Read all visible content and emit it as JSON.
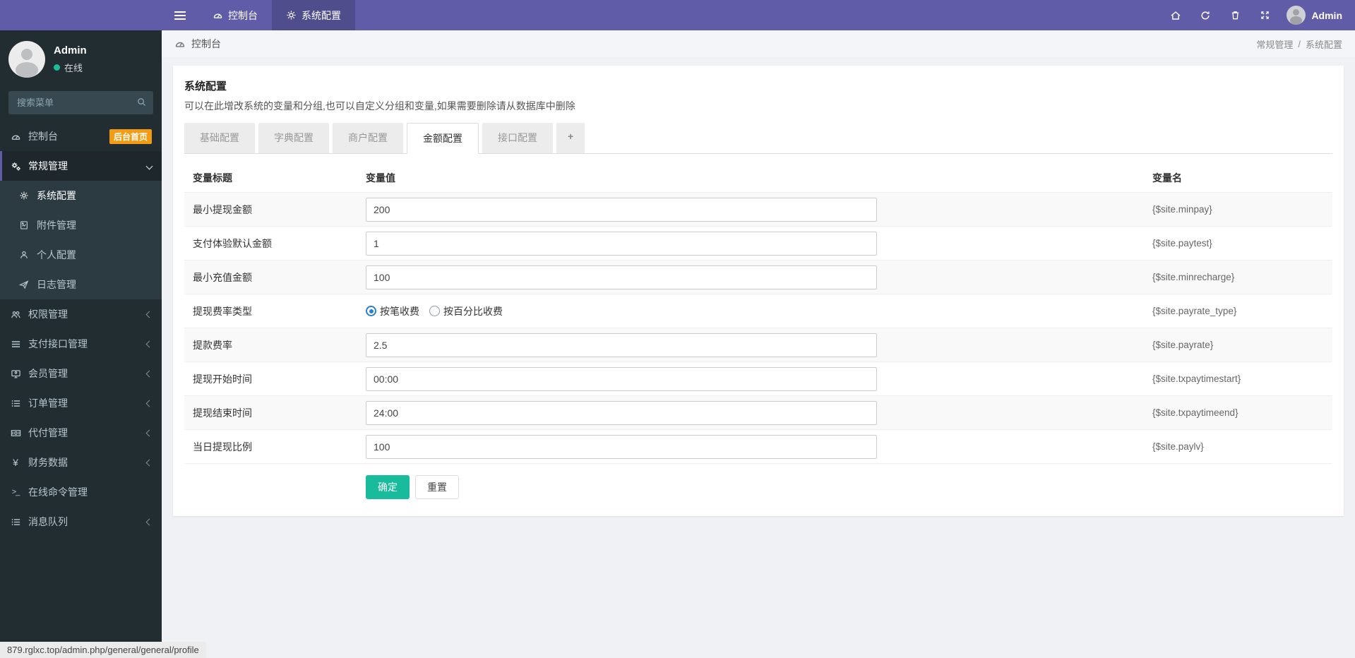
{
  "colors": {
    "navbar_purple": "#605ca8",
    "sidebar_dark": "#222d32",
    "submenu_dark": "#2c3b41",
    "badge_orange": "#f39c12",
    "success_green": "#18bc9c",
    "radio_blue": "#2a7fd1"
  },
  "navbar": {
    "tabs": [
      "控制台",
      "系统配置"
    ],
    "user": "Admin",
    "icons": [
      "home-icon",
      "refresh-icon",
      "trash-icon",
      "expand-icon"
    ]
  },
  "sidebar": {
    "profile": {
      "name": "Admin",
      "status": "在线"
    },
    "search_placeholder": "搜索菜单",
    "menu": [
      {
        "label": "控制台",
        "badge": "后台首页"
      },
      {
        "label": "常规管理",
        "children": [
          "系统配置",
          "附件管理",
          "个人配置",
          "日志管理"
        ]
      },
      {
        "label": "权限管理"
      },
      {
        "label": "支付接口管理"
      },
      {
        "label": "会员管理"
      },
      {
        "label": "订单管理"
      },
      {
        "label": "代付管理"
      },
      {
        "label": "财务数据"
      },
      {
        "label": "在线命令管理"
      },
      {
        "label": "消息队列"
      }
    ]
  },
  "main": {
    "breadcrumb": {
      "left": "控制台",
      "trail": [
        "常规管理",
        "系统配置"
      ],
      "separator": "/"
    },
    "panel": {
      "title": "系统配置",
      "description": "可以在此增改系统的变量和分组,也可以自定义分组和变量,如果需要删除请从数据库中删除",
      "tabs": [
        "基础配置",
        "字典配置",
        "商户配置",
        "金额配置",
        "接口配置",
        "+"
      ],
      "active_tab": "金额配置"
    },
    "table": {
      "headers": [
        "变量标题",
        "变量值",
        "变量名"
      ],
      "rows": [
        {
          "title": "最小提现金额",
          "type": "input",
          "value": "200",
          "var": "{$site.minpay}"
        },
        {
          "title": "支付体验默认金额",
          "type": "input",
          "value": "1",
          "var": "{$site.paytest}"
        },
        {
          "title": "最小充值金额",
          "type": "input",
          "value": "100",
          "var": "{$site.minrecharge}"
        },
        {
          "title": "提现费率类型",
          "type": "radio",
          "options": [
            {
              "label": "按笔收费",
              "checked": true
            },
            {
              "label": "按百分比收费",
              "checked": false
            }
          ],
          "var": "{$site.payrate_type}"
        },
        {
          "title": "提款费率",
          "type": "input",
          "value": "2.5",
          "var": "{$site.payrate}"
        },
        {
          "title": "提现开始时间",
          "type": "input",
          "value": "00:00",
          "var": "{$site.txpaytimestart}"
        },
        {
          "title": "提现结束时间",
          "type": "input",
          "value": "24:00",
          "var": "{$site.txpaytimeend}"
        },
        {
          "title": "当日提现比例",
          "type": "input",
          "value": "100",
          "var": "{$site.paylv}"
        }
      ]
    },
    "buttons": {
      "submit": "确定",
      "reset": "重置"
    }
  },
  "icons": {
    "yen_glyph": "¥",
    "terminal_glyph": "&gt;_"
  },
  "statusbar": {
    "url": "879.rglxc.top/admin.php/general/general/profile"
  }
}
